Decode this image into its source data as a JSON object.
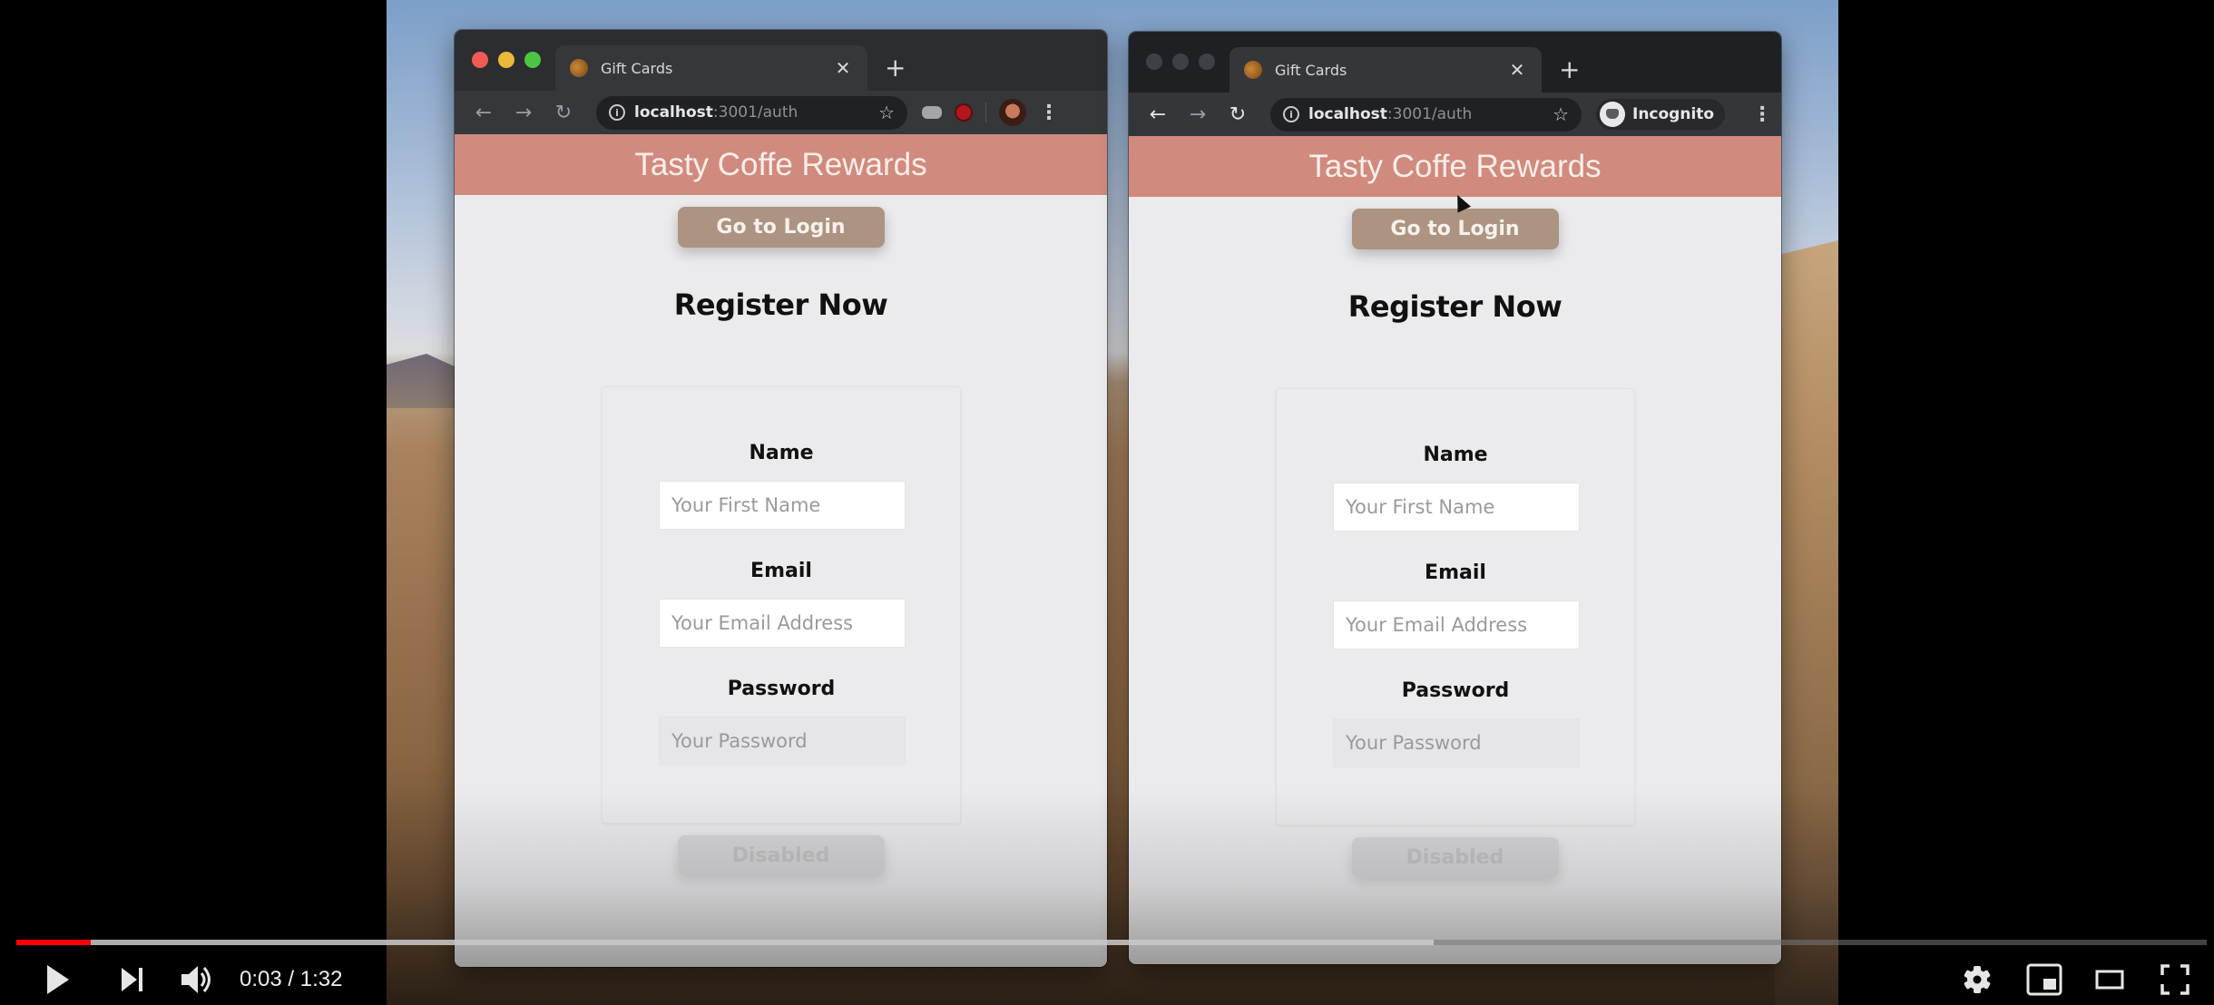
{
  "player": {
    "current_time": "0:03",
    "duration": "1:32",
    "time_display": "0:03 / 1:32",
    "played_fraction": 0.034,
    "buffered_fraction": 0.647,
    "colors": {
      "played": "#ff0000",
      "buffered": "#dcdcdc",
      "track": "#787878"
    },
    "controls": {
      "play": "play-icon",
      "next": "next-icon",
      "volume": "volume-icon",
      "settings": "gear-icon",
      "miniplayer": "miniplayer-icon",
      "theater": "theater-mode-icon",
      "fullscreen": "fullscreen-icon"
    }
  },
  "browsers": [
    {
      "mode": "normal",
      "tab_title": "Gift Cards",
      "url_host": "localhost",
      "url_path": ":3001/auth",
      "page": {
        "header_title": "Tasty Coffe Rewards",
        "login_button": "Go to Login",
        "heading": "Register Now",
        "fields": [
          {
            "label": "Name",
            "placeholder": "Your First Name",
            "value": ""
          },
          {
            "label": "Email",
            "placeholder": "Your Email Address",
            "value": ""
          },
          {
            "label": "Password",
            "placeholder": "Your Password",
            "value": ""
          }
        ],
        "submit_button": "Disabled"
      }
    },
    {
      "mode": "incognito",
      "tab_title": "Gift Cards",
      "url_host": "localhost",
      "url_path": ":3001/auth",
      "incognito_label": "Incognito",
      "page": {
        "header_title": "Tasty Coffe Rewards",
        "login_button": "Go to Login",
        "heading": "Register Now",
        "fields": [
          {
            "label": "Name",
            "placeholder": "Your First Name",
            "value": ""
          },
          {
            "label": "Email",
            "placeholder": "Your Email Address",
            "value": ""
          },
          {
            "label": "Password",
            "placeholder": "Your Password",
            "value": ""
          }
        ],
        "submit_button": "Disabled"
      }
    }
  ],
  "theme": {
    "header_color": "#d08a7e",
    "login_button_color": "#ad9381",
    "page_background": "#ebebed"
  }
}
